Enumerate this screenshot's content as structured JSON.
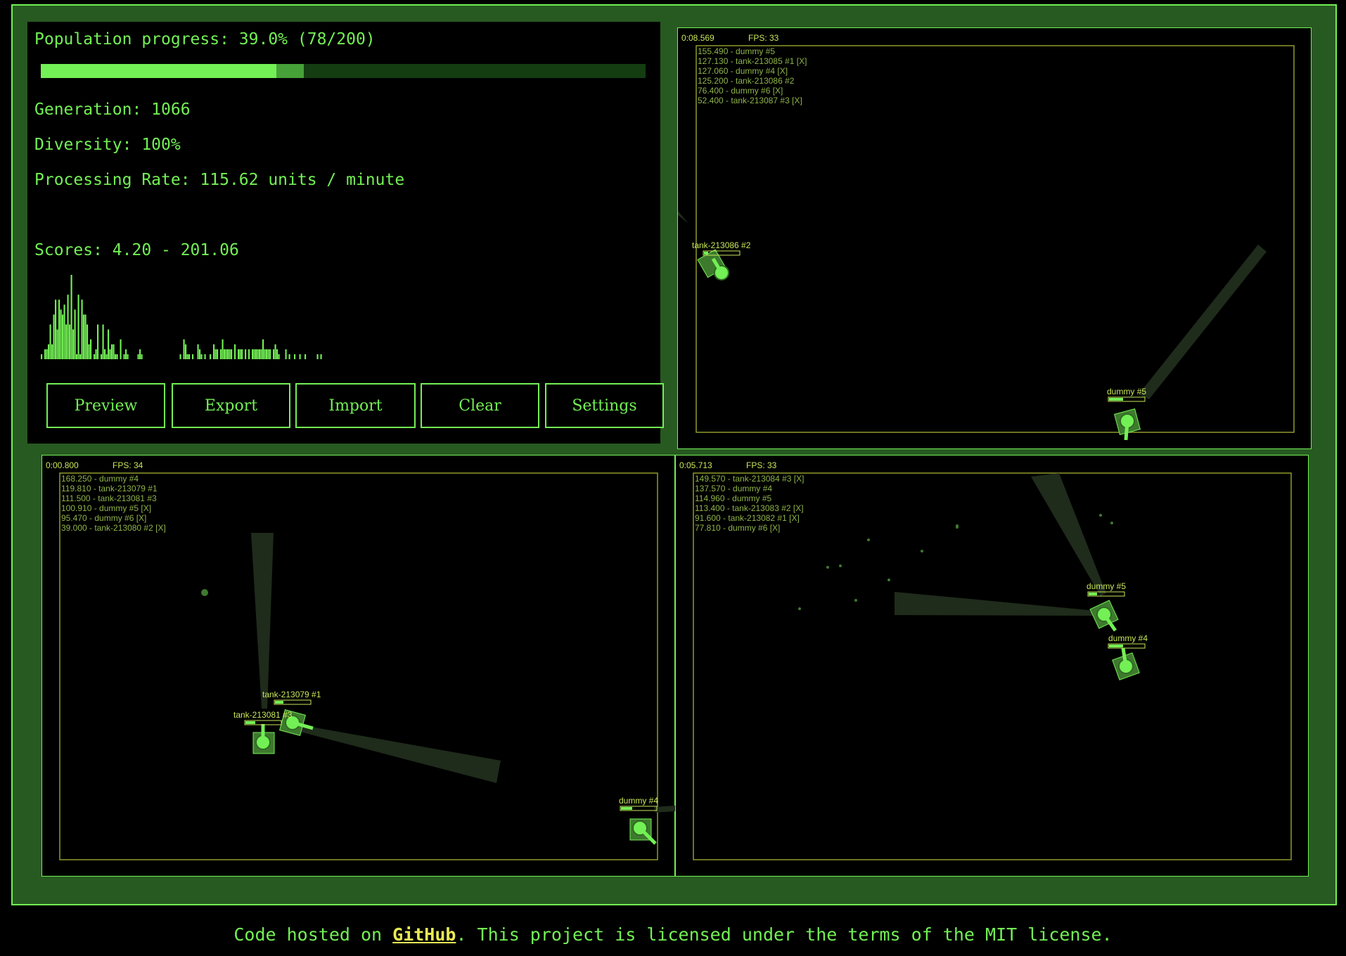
{
  "stats": {
    "population_progress": "Population progress: 39.0% (78/200)",
    "progress_fraction": 0.39,
    "progress_active_fraction": 0.045,
    "generation": "Generation: 1066",
    "diversity": "Diversity: 100%",
    "processing_rate": "Processing Rate: 115.62 units / minute",
    "scores": "Scores: 4.20 - 201.06",
    "histogram": [
      1,
      0,
      2,
      2,
      3,
      7,
      3,
      9,
      12,
      6,
      12,
      10,
      9,
      11,
      7,
      13,
      7,
      17,
      6,
      10,
      1,
      13,
      1,
      12,
      9,
      9,
      7,
      3,
      4,
      0,
      1,
      2,
      7,
      0,
      1,
      7,
      2,
      1,
      6,
      2,
      3,
      3,
      1,
      1,
      0,
      4,
      0,
      1,
      2,
      1,
      0,
      0,
      0,
      0,
      0,
      1,
      2,
      1,
      0,
      0,
      0,
      0,
      0,
      0,
      0,
      0,
      0,
      0,
      0,
      0,
      0,
      0,
      0,
      0,
      0,
      0,
      0,
      0,
      0,
      1,
      0,
      4,
      3,
      1,
      1,
      0,
      1,
      0,
      0,
      3,
      2,
      1,
      0,
      1,
      0,
      0,
      1,
      0,
      3,
      2,
      2,
      0,
      2,
      4,
      2,
      2,
      2,
      2,
      2,
      0,
      3,
      0,
      2,
      2,
      2,
      0,
      2,
      0,
      2,
      0,
      2,
      2,
      2,
      2,
      2,
      2,
      4,
      2,
      2,
      2,
      2,
      0,
      2,
      3,
      2,
      1,
      0,
      0,
      0,
      2,
      0,
      1,
      0,
      0,
      1,
      0,
      0,
      1,
      0,
      0,
      1,
      0,
      0,
      0,
      0,
      0,
      0,
      1,
      0,
      1
    ]
  },
  "buttons": {
    "preview": "Preview",
    "export": "Export",
    "import": "Import",
    "clear": "Clear",
    "settings": "Settings"
  },
  "arenas": {
    "a1": {
      "time": "0:08.569",
      "fps": "FPS: 33",
      "scores": [
        "155.490 - dummy #5",
        "127.130 - tank-213085 #1 [X]",
        "127.060 - dummy #4 [X]",
        "125.200 - tank-213086 #2",
        "76.400 - dummy #6 [X]",
        "52.400 - tank-213087 #3 [X]"
      ],
      "tank1_label": "tank-213086 #2",
      "tank2_label": "dummy #5"
    },
    "a2": {
      "time": "0:00.800",
      "fps": "FPS: 34",
      "scores": [
        "168.250 - dummy #4",
        "119.810 - tank-213079 #1",
        "111.500 - tank-213081 #3",
        "100.910 - dummy #5 [X]",
        "95.470 - dummy #6 [X]",
        "39.000 - tank-213080 #2 [X]"
      ],
      "tank1_label": "tank-213079 #1",
      "tank2_label": "tank-213081 #3",
      "tank3_label": "dummy #4"
    },
    "a3": {
      "time": "0:05.713",
      "fps": "FPS: 33",
      "scores": [
        "149.570 - tank-213084 #3 [X]",
        "137.570 - dummy #4",
        "114.960 - dummy #5",
        "113.400 - tank-213083 #2 [X]",
        "91.600 - tank-213082 #1 [X]",
        "77.810 - dummy #6 [X]"
      ],
      "tank1_label": "dummy #5",
      "tank2_label": "dummy #4"
    }
  },
  "footer": {
    "prefix": "Code hosted on ",
    "link": "GitHub",
    "suffix": ". This project is licensed under the terms of the MIT license."
  },
  "colors": {
    "accent": "#73f055",
    "frame": "#275a21",
    "arena_border": "#8f9a2a",
    "hud": "#c8e85a"
  }
}
